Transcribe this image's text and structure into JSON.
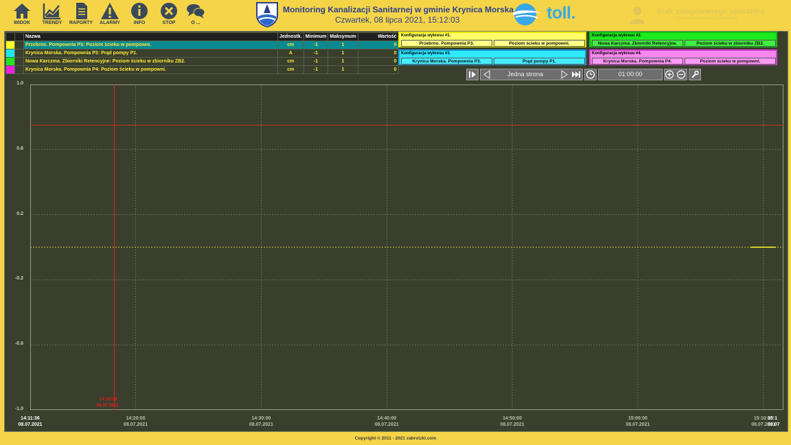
{
  "toolbar": {
    "items": [
      {
        "label": "WIDOK",
        "icon": "home-icon"
      },
      {
        "label": "TRENDY",
        "icon": "trend-chart-icon"
      },
      {
        "label": "RAPORTY",
        "icon": "document-icon"
      },
      {
        "label": "ALARMY",
        "icon": "warning-icon"
      },
      {
        "label": "INFO",
        "icon": "info-icon"
      },
      {
        "label": "STOP",
        "icon": "stop-icon"
      },
      {
        "label": "O ...",
        "icon": "chat-icon"
      }
    ]
  },
  "header": {
    "title": "Monitoring Kanalizacji Sanitarnej w gminie Krynica Morska.",
    "datetime": "Czwartek, 08 lipca 2021, 15:12:03",
    "brand": "toll.",
    "operator_status": "Brak zalogowanego operatora",
    "operator_sub": "(nazwa zalogowanego operatora)"
  },
  "series_table": {
    "columns": [
      "Nazwa",
      "Jednostk.",
      "Minimum",
      "Maksymum",
      "Wartość"
    ],
    "rows": [
      {
        "color": "#ffff2a",
        "name": "Przebrno. Pompownia P3: Poziom ścieku w pompowni.",
        "unit": "cm",
        "min": "-1",
        "max": "1",
        "value": "0",
        "selected": true
      },
      {
        "color": "#1ee8ff",
        "name": "Krynica Morska. Pompownia P3: Prąd pompy P1.",
        "unit": "A",
        "min": "-1",
        "max": "1",
        "value": "0",
        "selected": false
      },
      {
        "color": "#22e322",
        "name": "Nowa Karczma. Zbiorniki Retencyjne: Poziom ścieku w zbiorniku ZB2.",
        "unit": "cm",
        "min": "-1",
        "max": "1",
        "value": "0",
        "selected": false
      },
      {
        "color": "#f01ee0",
        "name": "Krynica Morska. Pompownia P4: Poziom ścieku w pompowni.",
        "unit": "cm",
        "min": "-1",
        "max": "1",
        "value": "0",
        "selected": false
      }
    ]
  },
  "configs": [
    {
      "title": "Konfiguracja wykresu #1.",
      "a": "Przebrno. Pompownia P3.",
      "b": "Poziom ścieku w pompowni.",
      "bg": "#ffff66",
      "border": "#e8e800",
      "btn": "#ffff88"
    },
    {
      "title": "Konfiguracja wykresu #2.",
      "a": "Nowa Karczma. Zbiorniki Retencyjne.",
      "b": "Poziom ścieku w zbiorniku ZB2.",
      "bg": "#1ee81e",
      "border": "#10c010",
      "btn": "#40f040"
    },
    {
      "title": "Konfiguracja wykresu #3.",
      "a": "Krynica Morska. Pompownia P3.",
      "b": "Prąd pompy P1.",
      "bg": "#2ee8ff",
      "border": "#1a9ad8",
      "btn": "#44eeff"
    },
    {
      "title": "Konfiguracja wykresu #4.",
      "a": "Krynica Morska. Pompownia P4.",
      "b": "Poziom ścieku w pompowni.",
      "bg": "#f888f0",
      "border": "#d040d0",
      "btn": "#ff99f5"
    }
  ],
  "navigation": {
    "page_mode": "Jedna strona",
    "interval": "01:00:00"
  },
  "chart_data": {
    "type": "line",
    "ylim": [
      -1.0,
      1.0
    ],
    "yticks": [
      "1.0",
      "0.6",
      "0.2",
      "-0.2",
      "-0.6",
      "-1.0"
    ],
    "xlim": [
      "14:11:36",
      "15:11:36"
    ],
    "xticks": [
      {
        "time": "14:11:36",
        "date": "08.07.2021"
      },
      {
        "time": "14:20:00",
        "date": "08.07.2021"
      },
      {
        "time": "14:30:00",
        "date": "08.07.2021"
      },
      {
        "time": "14:40:00",
        "date": "08.07.2021"
      },
      {
        "time": "14:50:00",
        "date": "08.07.2021"
      },
      {
        "time": "15:00:00",
        "date": "08.07.2021"
      },
      {
        "time": "15:10:00",
        "date": "08.07.2021"
      },
      {
        "time": "15:1",
        "date": "08.07"
      }
    ],
    "cursor": {
      "time": "14:18:18",
      "date": "08.07.2021"
    },
    "hline_y": 0.75,
    "series": [
      {
        "color": "#ffff2a",
        "x": [
          "15:09:00",
          "15:11:00"
        ],
        "y": [
          0,
          0
        ]
      }
    ],
    "reference_y": 0,
    "grid": true
  },
  "footer": {
    "copyright": "Copyright © 2011 - 2021 zabrotzki.com"
  }
}
